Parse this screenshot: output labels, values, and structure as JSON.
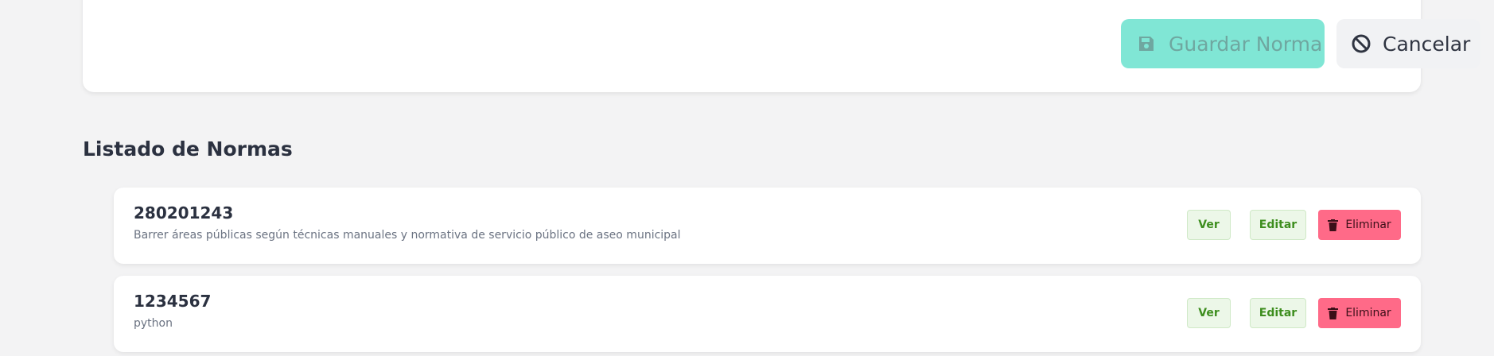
{
  "form": {
    "save_label": "Guardar Norma",
    "cancel_label": "Cancelar",
    "save_icon": "floppy-disk-icon",
    "cancel_icon": "ban-icon"
  },
  "list": {
    "title": "Listado de Normas",
    "items": [
      {
        "code": "280201243",
        "description": "Barrer áreas públicas según técnicas manuales y normativa de servicio público de aseo municipal",
        "view_label": "Ver",
        "edit_label": "Editar",
        "delete_label": "Eliminar"
      },
      {
        "code": "1234567",
        "description": "python",
        "view_label": "Ver",
        "edit_label": "Editar",
        "delete_label": "Eliminar"
      }
    ]
  },
  "colors": {
    "save_bg": "#80e6d5",
    "delete_bg": "#ff6a88",
    "action_green": "#3e8e1f"
  }
}
